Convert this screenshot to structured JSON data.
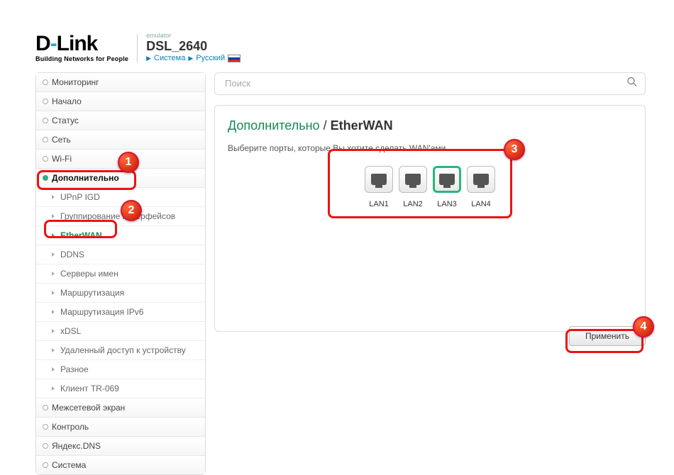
{
  "header": {
    "brand_top": "D-Link",
    "brand_sub": "Building Networks for People",
    "emulator_label": "emulator",
    "model": "DSL_2640",
    "link_system": "Система",
    "link_lang": "Русский"
  },
  "search": {
    "placeholder": "Поиск"
  },
  "sidebar": {
    "items": [
      {
        "label": "Мониторинг"
      },
      {
        "label": "Начало"
      },
      {
        "label": "Статус"
      },
      {
        "label": "Сеть"
      },
      {
        "label": "Wi-Fi"
      },
      {
        "label": "Дополнительно",
        "expanded": true
      },
      {
        "label": "Межсетевой экран"
      },
      {
        "label": "Контроль"
      },
      {
        "label": "Яндекс.DNS"
      },
      {
        "label": "Система"
      }
    ],
    "advanced_children": [
      {
        "label": "UPnP IGD"
      },
      {
        "label": "Группирование интерфейсов"
      },
      {
        "label": "EtherWAN",
        "active": true
      },
      {
        "label": "DDNS"
      },
      {
        "label": "Серверы имен"
      },
      {
        "label": "Маршрутизация"
      },
      {
        "label": "Маршрутизация IPv6"
      },
      {
        "label": "xDSL"
      },
      {
        "label": "Удаленный доступ к устройству"
      },
      {
        "label": "Разное"
      },
      {
        "label": "Клиент TR-069"
      }
    ]
  },
  "main": {
    "breadcrumb_root": "Дополнительно",
    "breadcrumb_sep": " / ",
    "breadcrumb_leaf": "EtherWAN",
    "hint": "Выберите порты, которые Вы хотите сделать WAN'ами.",
    "ports": [
      "LAN1",
      "LAN2",
      "LAN3",
      "LAN4"
    ],
    "selected_port_index": 2,
    "apply_label": "Применить"
  },
  "annotations": {
    "nums": [
      "1",
      "2",
      "3",
      "4"
    ]
  }
}
